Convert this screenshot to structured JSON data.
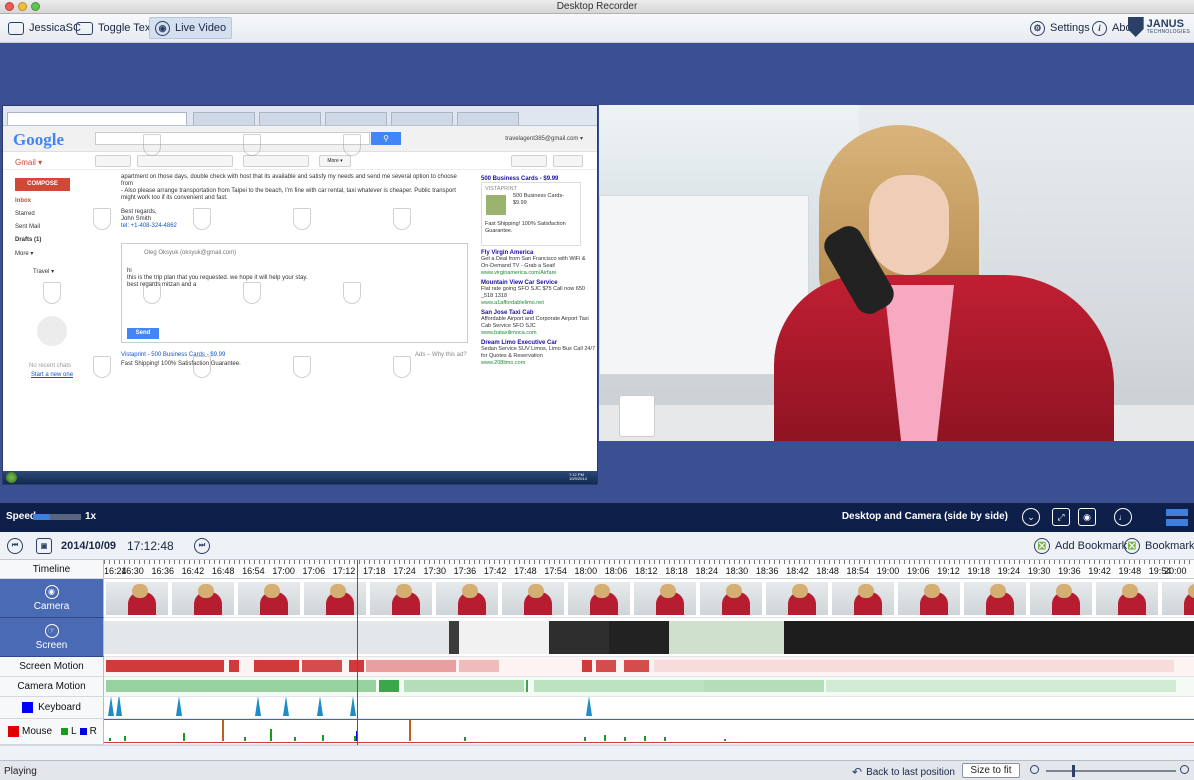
{
  "window": {
    "title": "Desktop Recorder"
  },
  "toolbar": {
    "user_label": "JessicaSC",
    "toggle_text_label": "Toggle Text",
    "live_video_label": "Live Video",
    "settings_label": "Settings",
    "about_label": "About",
    "brand": {
      "name": "JANUS",
      "sub": "TECHNOLOGIES"
    }
  },
  "desktop_capture": {
    "google_logo": "Google",
    "gmail_label": "Gmail ▾",
    "account": "travelagent385@gmail.com ▾",
    "more_label": "More ▾",
    "compose_label": "COMPOSE",
    "nav": [
      "Inbox",
      "Starred",
      "Sent Mail",
      "Drafts (1)",
      "More ▾"
    ],
    "chat_user": "Travel ▾",
    "no_chats": "No recent chats",
    "start_chat": "Start a new one",
    "mail_lines": [
      "apartment on those days, double check with host that its available and satisfy my needs and send me several option to choose",
      "from",
      "- Also please arrange transportation from Taipei to the beach, I'm fine with car rental, taxi whatever is cheaper. Public transport",
      "might work too if its convenient and fast.",
      "Best regards,",
      "John Smith",
      "tel: +1-408-324-4862"
    ],
    "reply_to": "Oleg Oksyuk (oksyuk@gmail.com)",
    "reply_lines": [
      "hi",
      "this is the trip plan that you requested. we hope it will help your stay.",
      "best regards mitzan and a"
    ],
    "send_label": "Send",
    "bottom_ad_title": "Vistaprint - 500 Business Cards - $9.99",
    "bottom_ad_body": "Fast Shipping! 100% Satisfaction Guarantee.",
    "bottom_ad_right": "Ads – Why this ad?",
    "top_ad": "500 Business Cards - $9.99",
    "vistaprint_box": {
      "brand": "VISTAPRINT",
      "title": "500 Business Cards- $9.99",
      "body": "Fast Shipping! 100% Satisfaction Guarantee."
    },
    "ads": [
      {
        "title": "Fly Virgin America",
        "body": "Get a Deal from San Francisco with WiFi & On-Demand TV - Grab a Seat!",
        "url": "www.virginamerica.com/Airfare"
      },
      {
        "title": "Mountain View Car Service",
        "body": "Flat rate going SFO SJC $75 Call now 650 _518 1318",
        "url": "www.a1affordablelimo.net"
      },
      {
        "title": "San Jose Taxi Cab",
        "body": "Affordable Airport and Corporate Airport Taxi Cab Service SFO SJC",
        "url": "www.bataxilimoca.com"
      },
      {
        "title": "Dream Limo Executive Car",
        "body": "Sedan Service SUV Limos, Limo Bus Call 24/7 for Quotes & Reservation",
        "url": "www.208limo.com"
      }
    ],
    "clock": "7:12 PM 10/9/2014"
  },
  "video_status": {
    "speed_label": "Speed",
    "speed_value": "1x",
    "speed_fraction": 0.35,
    "mode_label": "Desktop and Camera (side by side)"
  },
  "timeline": {
    "date": "2014/10/09",
    "time": "17:12:48",
    "add_bookmark_label": "Add Bookmark",
    "bookmarks_label": "Bookmarks",
    "ruler_label": "Timeline",
    "ticks": [
      "16:24",
      "16:30",
      "16:36",
      "16:42",
      "16:48",
      "16:54",
      "17:00",
      "17:06",
      "17:12",
      "17:18",
      "17:24",
      "17:30",
      "17:36",
      "17:42",
      "17:48",
      "17:54",
      "18:00",
      "18:06",
      "18:12",
      "18:18",
      "18:24",
      "18:30",
      "18:36",
      "18:42",
      "18:48",
      "18:54",
      "19:00",
      "19:06",
      "19:12",
      "19:18",
      "19:24",
      "19:30",
      "19:36",
      "19:42",
      "19:48",
      "19:54",
      "20:00"
    ],
    "tracks": {
      "camera": "Camera",
      "screen": "Screen",
      "screen_motion": "Screen Motion",
      "camera_motion": "Camera Motion",
      "keyboard": "Keyboard",
      "mouse": "Mouse",
      "mouse_left": "L",
      "mouse_right": "R"
    },
    "colors": {
      "keyboard": "#0000ff",
      "mouse": "#e00000",
      "left": "#1a9a1a",
      "right": "#0000e0",
      "screen_motion": "#d03a3a",
      "camera_motion": "#3aa84a"
    }
  },
  "statusbar": {
    "status": "Playing",
    "back_label": "Back to last position",
    "size_to_fit_label": "Size to fit",
    "zoom_fraction": 0.2
  }
}
